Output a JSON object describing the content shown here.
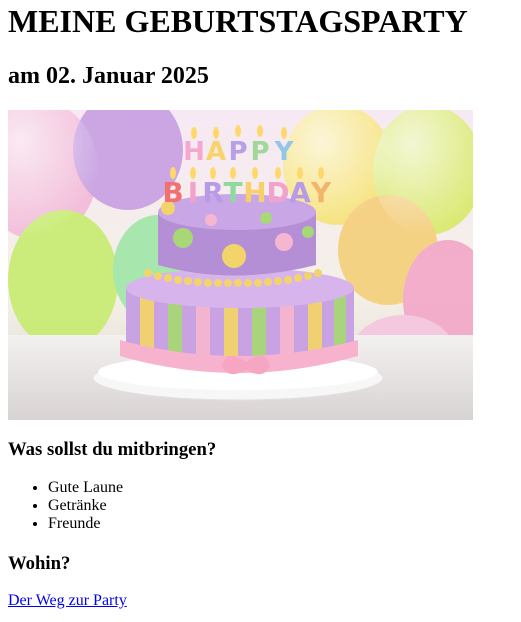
{
  "header": {
    "title": "MEINE GEBURTSTAGSPARTY",
    "subtitle": "am 02. Januar 2025"
  },
  "hero": {
    "icon": "birthday-cake-image",
    "letters_line1": [
      "H",
      "A",
      "P",
      "P",
      "Y"
    ],
    "letters_line2": [
      "B",
      "I",
      "R",
      "T",
      "H",
      "D",
      "A",
      "Y"
    ]
  },
  "bring": {
    "heading": "Was sollst du mitbringen?",
    "items": [
      "Gute Laune",
      "Getränke",
      "Freunde"
    ]
  },
  "where": {
    "heading": "Wohin?",
    "link_label": "Der Weg zur Party"
  },
  "colors": {
    "link": "#0000ee",
    "cake_purple": "#b58fd6",
    "cake_yellow": "#f2d46b"
  }
}
